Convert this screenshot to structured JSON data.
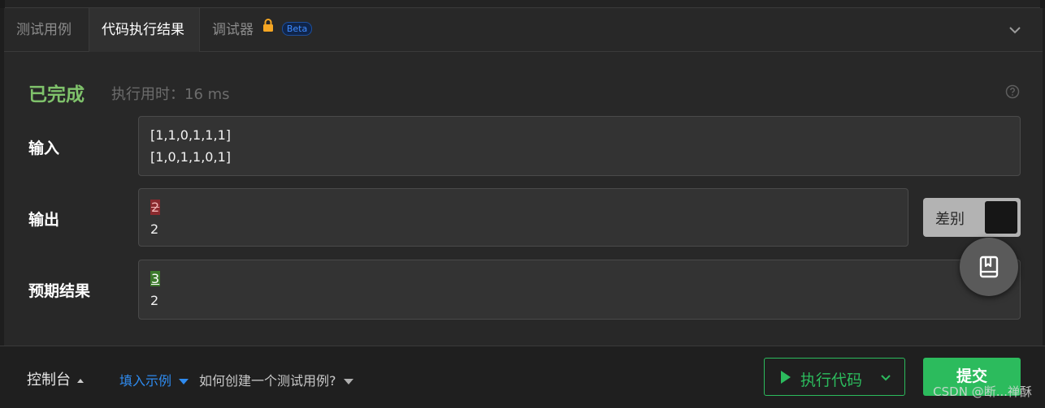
{
  "tabs": {
    "testcase": "测试用例",
    "result": "代码执行结果",
    "debugger": "调试器",
    "beta": "Beta"
  },
  "result": {
    "status": "已完成",
    "runtime": "执行用时：16 ms"
  },
  "rows": {
    "input_label": "输入",
    "input_lines": [
      "[1,1,0,1,1,1]",
      "[1,0,1,1,0,1]"
    ],
    "output_label": "输出",
    "output_diff_value": "2",
    "output_value": "2",
    "expected_label": "预期结果",
    "expected_diff_value": "3",
    "expected_value": "2"
  },
  "diff_toggle": {
    "label": "差别"
  },
  "bottom": {
    "console": "控制台",
    "fill_example": "填入示例",
    "howto": "如何创建一个测试用例?",
    "run": "执行代码",
    "submit": "提交"
  },
  "watermark": "CSDN @断...禅酥",
  "icons": {
    "lock": "lock-icon",
    "collapse": "chevron-down-icon",
    "help": "question-circle-icon",
    "fab": "bookmark-book-icon",
    "play": "play-icon"
  },
  "colors": {
    "accent_green": "#2cbb5d",
    "status_green": "#7fc26b",
    "link_blue": "#2f8bef",
    "diff_removed": "#8a2a2e",
    "diff_added": "#3d7a2c"
  }
}
